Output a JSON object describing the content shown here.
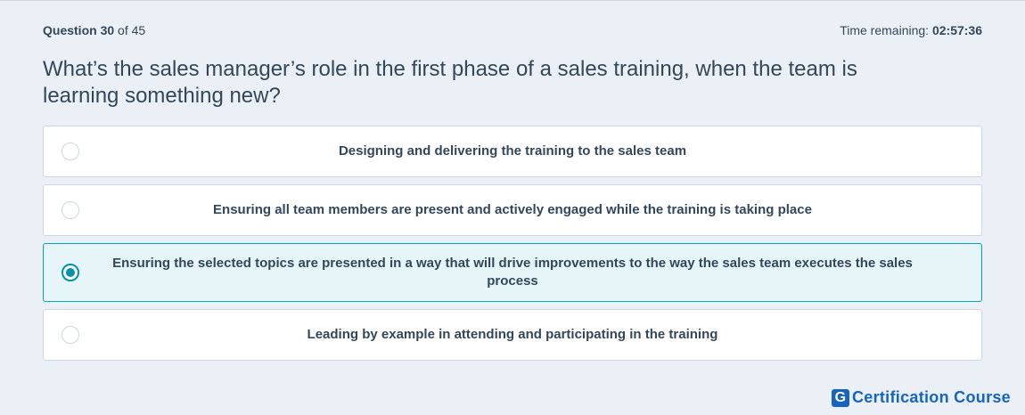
{
  "header": {
    "question_label": "Question",
    "question_number": "30",
    "of_total": "of 45",
    "timer_label": "Time remaining:",
    "timer_value": "02:57:36"
  },
  "question": {
    "text": "What’s the sales manager’s role in the first phase of a sales training, when the team is learning something new?"
  },
  "options": [
    {
      "label": "Designing and delivering the training to the sales team",
      "selected": false
    },
    {
      "label": "Ensuring all team members are present and actively engaged while the training is taking place",
      "selected": false
    },
    {
      "label": "Ensuring the selected topics are presented in a way that will drive improvements to the way the sales team executes the sales process",
      "selected": true
    },
    {
      "label": "Leading by example in attending and participating in the training",
      "selected": false
    }
  ],
  "brand": {
    "logo_letter": "G",
    "name": "Certification Course",
    "color": "#1565c0"
  },
  "colors": {
    "background": "#eaf0f6",
    "text": "#33475b",
    "selected_border": "#00a4bd",
    "selected_bg": "#e5f5f8",
    "radio_selected": "#0091ae"
  }
}
